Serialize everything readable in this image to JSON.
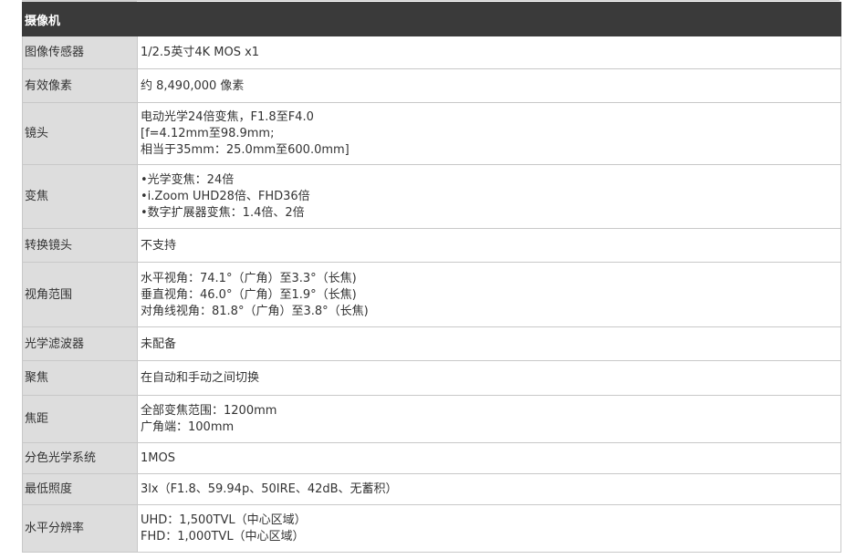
{
  "section": {
    "title": "摄像机"
  },
  "rows": [
    {
      "label": "图像传感器",
      "lines": [
        "1/2.5英寸4K MOS x1"
      ]
    },
    {
      "label": "有效像素",
      "lines": [
        "约 8,490,000 像素"
      ]
    },
    {
      "label": "镜头",
      "lines": [
        "电动光学24倍变焦，F1.8至F4.0",
        "[f=4.12mm至98.9mm;",
        "相当于35mm：25.0mm至600.0mm]"
      ]
    },
    {
      "label": "变焦",
      "lines": [
        "•光学变焦：24倍",
        "•i.Zoom UHD28倍、FHD36倍",
        "•数字扩展器变焦：1.4倍、2倍"
      ]
    },
    {
      "label": "转换镜头",
      "lines": [
        "不支持"
      ]
    },
    {
      "label": "视角范围",
      "lines": [
        "水平视角：74.1°（广角）至3.3°（长焦)",
        "垂直视角：46.0°（广角）至1.9°（长焦)",
        "对角线视角：81.8°（广角）至3.8°（长焦)"
      ]
    },
    {
      "label": "光学滤波器",
      "lines": [
        "未配备"
      ]
    },
    {
      "label": "聚焦",
      "lines": [
        "在自动和手动之间切换"
      ]
    },
    {
      "label": "焦距",
      "lines": [
        "全部变焦范围：1200mm",
        "广角端：100mm"
      ]
    },
    {
      "label": "分色光学系统",
      "lines": [
        "1MOS"
      ]
    },
    {
      "label": "最低照度",
      "lines": [
        "3lx（F1.8、59.94p、50IRE、42dB、无蓄积）"
      ]
    },
    {
      "label": "水平分辨率",
      "lines": [
        "UHD：1,500TVL（中心区域）",
        "FHD：1,000TVL（中心区域）"
      ]
    }
  ]
}
